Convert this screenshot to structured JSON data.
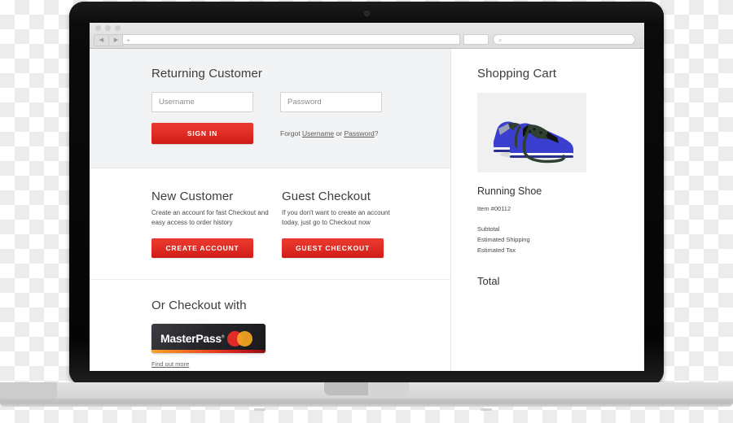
{
  "browser": {
    "address_placeholder": "",
    "address_value": "+",
    "search_placeholder": "",
    "back_glyph": "◀",
    "forward_glyph": "▶",
    "search_glyph": "⌕"
  },
  "page": {
    "returning": {
      "heading": "Returning Customer",
      "username_placeholder": "Username",
      "username_value": "",
      "password_placeholder": "Password",
      "password_value": "",
      "signin_label": "SIGN IN",
      "forgot_prefix": "Forgot ",
      "forgot_username": "Username",
      "forgot_mid": " or ",
      "forgot_password": "Password",
      "forgot_suffix": "?"
    },
    "new_customer": {
      "heading": "New Customer",
      "description": "Create an account for fast Checkout and easy access to order history",
      "button_label": "CREATE ACCOUNT"
    },
    "guest_checkout": {
      "heading": "Guest Checkout",
      "description": "If you don't want  to create an account today, just go to Checkout now",
      "button_label": "GUEST CHECKOUT"
    },
    "masterpass": {
      "heading": "Or Checkout with",
      "logo_text": "MasterPass",
      "logo_tm": "®",
      "find_out_more": "Find out more"
    },
    "cart": {
      "heading": "Shopping Cart",
      "product_name": "Running Shoe",
      "item_number": "Item #00112",
      "lines": [
        "Subtotal",
        "Estimated Shipping",
        "Estimated Tax"
      ],
      "total_label": "Total"
    }
  },
  "colors": {
    "accent_red": "#e12e25",
    "panel_gray": "#f2f3f5",
    "text_dark": "#3c3c3c",
    "mp_dark": "#26262b"
  }
}
